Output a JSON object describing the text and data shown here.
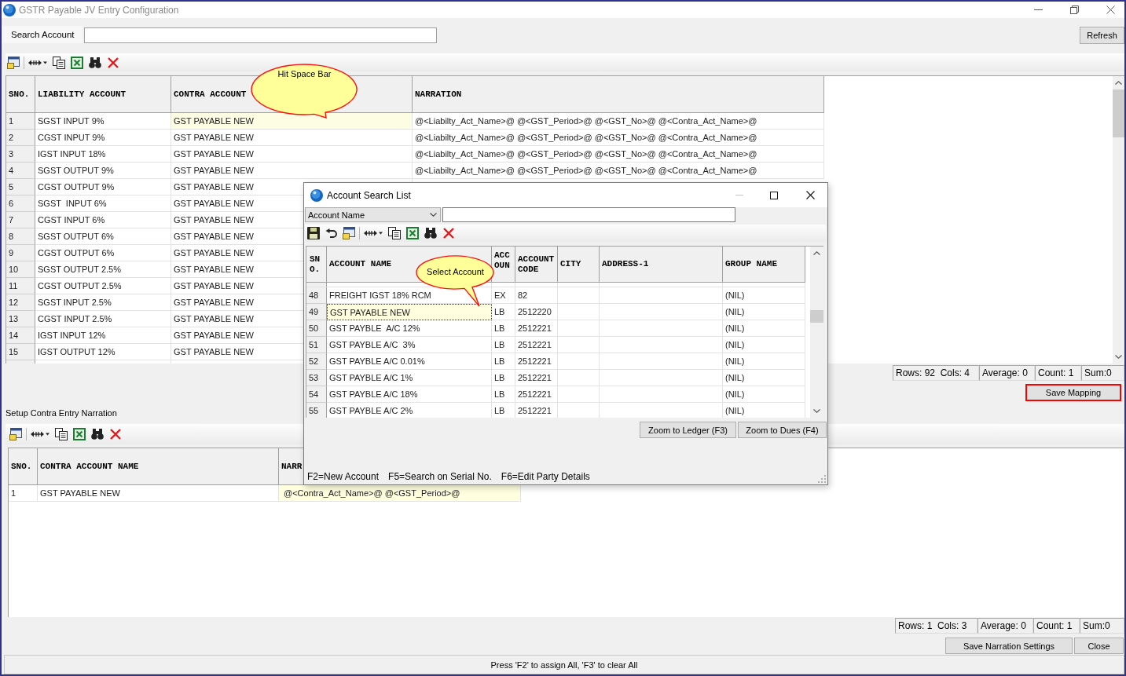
{
  "window": {
    "title": "GSTR Payable JV Entry Configuration"
  },
  "search": {
    "label": "Search Account"
  },
  "refresh_button": "Refresh",
  "liability_grid": {
    "callout": "Hit Space Bar",
    "columns": [
      "SNO.",
      "LIABILITY ACCOUNT",
      "CONTRA ACCOUNT",
      "NARRATION"
    ],
    "rows": [
      {
        "sno": "1",
        "liability": "SGST INPUT 9%",
        "contra": "GST PAYABLE NEW",
        "narration": "@<Liabilty_Act_Name>@ @<GST_Period>@ @<GST_No>@ @<Contra_Act_Name>@",
        "selected": true
      },
      {
        "sno": "2",
        "liability": "CGST INPUT 9%",
        "contra": "GST PAYABLE NEW",
        "narration": "@<Liabilty_Act_Name>@ @<GST_Period>@ @<GST_No>@ @<Contra_Act_Name>@",
        "selected": false
      },
      {
        "sno": "3",
        "liability": "IGST INPUT 18%",
        "contra": "GST PAYABLE NEW",
        "narration": "@<Liabilty_Act_Name>@ @<GST_Period>@ @<GST_No>@ @<Contra_Act_Name>@",
        "selected": false
      },
      {
        "sno": "4",
        "liability": "SGST OUTPUT 9%",
        "contra": "GST PAYABLE NEW",
        "narration": "@<Liabilty_Act_Name>@ @<GST_Period>@ @<GST_No>@ @<Contra_Act_Name>@",
        "selected": false
      },
      {
        "sno": "5",
        "liability": "CGST OUTPUT 9%",
        "contra": "GST PAYABLE NEW",
        "selected": false
      },
      {
        "sno": "6",
        "liability": "SGST  INPUT 6%",
        "contra": "GST PAYABLE NEW",
        "selected": false
      },
      {
        "sno": "7",
        "liability": "CGST INPUT 6%",
        "contra": "GST PAYABLE NEW",
        "selected": false
      },
      {
        "sno": "8",
        "liability": "SGST OUTPUT 6%",
        "contra": "GST PAYABLE NEW",
        "selected": false
      },
      {
        "sno": "9",
        "liability": "CGST OUTPUT 6%",
        "contra": "GST PAYABLE NEW",
        "selected": false
      },
      {
        "sno": "10",
        "liability": "SGST OUTPUT 2.5%",
        "contra": "GST PAYABLE NEW",
        "selected": false
      },
      {
        "sno": "11",
        "liability": "CGST OUTPUT 2.5%",
        "contra": "GST PAYABLE NEW",
        "selected": false
      },
      {
        "sno": "12",
        "liability": "SGST INPUT 2.5%",
        "contra": "GST PAYABLE NEW",
        "selected": false
      },
      {
        "sno": "13",
        "liability": "CGST INPUT 2.5%",
        "contra": "GST PAYABLE NEW",
        "selected": false
      },
      {
        "sno": "14",
        "liability": "IGST INPUT 12%",
        "contra": "GST PAYABLE NEW",
        "selected": false
      },
      {
        "sno": "15",
        "liability": "IGST OUTPUT 12%",
        "contra": "GST PAYABLE NEW",
        "selected": false
      }
    ]
  },
  "liability_status": [
    "Rows: 92  Cols: 4",
    "Average: 0",
    "Count: 1",
    "Sum:0"
  ],
  "save_mapping": {
    "label": "Save Mapping",
    "highlighted": true
  },
  "narration_section": {
    "title": "Setup Contra Entry Narration",
    "columns": [
      "SNO.",
      "CONTRA ACCOUNT NAME",
      "NARR"
    ],
    "rows": [
      {
        "sno": "1",
        "contra": "GST PAYABLE NEW",
        "narration": "@<Contra_Act_Name>@ @<GST_Period>@",
        "selected": true
      }
    ],
    "status": [
      "Rows: 1  Cols: 3",
      "Average: 0",
      "Count: 1",
      "Sum:0"
    ]
  },
  "buttons": [
    "Save Narration Settings",
    "Close"
  ],
  "status_bar": "Press 'F2' to assign All, 'F3' to clear All",
  "account_search": {
    "title": "Account Search List",
    "filter_field": "Account Name",
    "callout": "Select Account",
    "columns": [
      "SNO.",
      "ACCOUNT NAME",
      "ACCOUN",
      "ACCOUNT CODE",
      "CITY",
      "ADDRESS-1",
      "GROUP NAME"
    ],
    "rows": [
      {
        "sno": "48",
        "name": "FREIGHT IGST 18% RCM",
        "type": "EX",
        "code": "82",
        "group": "(NIL)",
        "selected": false
      },
      {
        "sno": "49",
        "name": "GST PAYABLE NEW",
        "type": "LB",
        "code": "2512220",
        "group": "(NIL)",
        "selected": true
      },
      {
        "sno": "50",
        "name": "GST PAYBLE  A/C 12%",
        "type": "LB",
        "code": "2512221",
        "group": "(NIL)",
        "selected": false
      },
      {
        "sno": "51",
        "name": "GST PAYBLE A/C  3%",
        "type": "LB",
        "code": "2512221",
        "group": "(NIL)",
        "selected": false
      },
      {
        "sno": "52",
        "name": "GST PAYBLE A/C 0.01%",
        "type": "LB",
        "code": "2512221",
        "group": "(NIL)",
        "selected": false
      },
      {
        "sno": "53",
        "name": "GST PAYBLE A/C 1%",
        "type": "LB",
        "code": "2512221",
        "group": "(NIL)",
        "selected": false
      },
      {
        "sno": "54",
        "name": "GST PAYBLE A/C 18%",
        "type": "LB",
        "code": "2512221",
        "group": "(NIL)",
        "selected": false
      },
      {
        "sno": "55",
        "name": "GST PAYBLE A/C 2%",
        "type": "LB",
        "code": "2512221",
        "group": "(NIL)",
        "selected": false
      }
    ],
    "buttons": [
      "Zoom to Ledger (F3)",
      "Zoom to Dues (F4)"
    ],
    "hints": [
      "F2=New Account",
      "F5=Search on Serial No.",
      "F6=Edit Party Details"
    ]
  }
}
